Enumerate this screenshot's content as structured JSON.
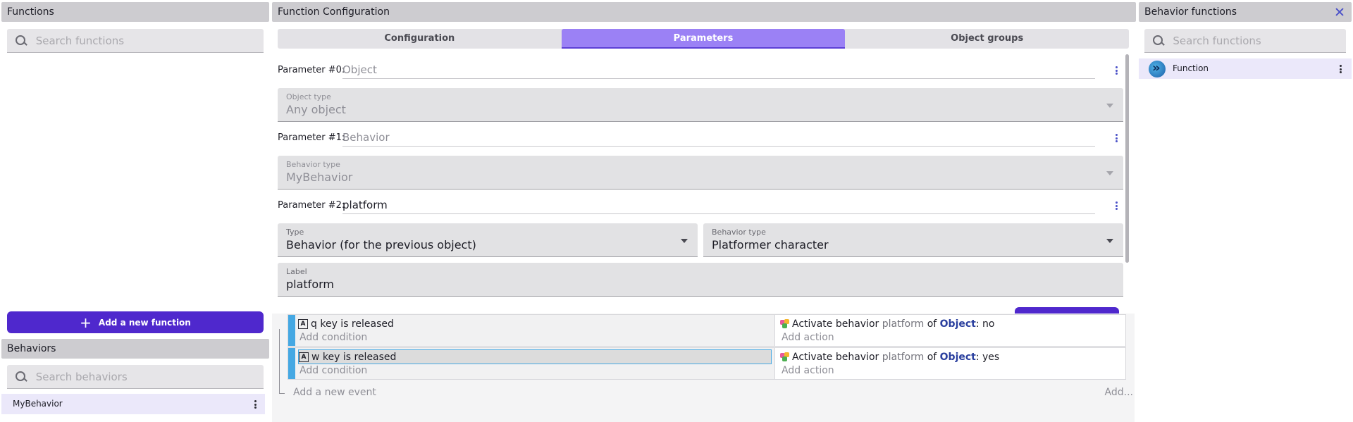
{
  "left": {
    "functions_title": "Functions",
    "functions_search_placeholder": "Search functions",
    "add_function_label": "Add a new function",
    "behaviors_title": "Behaviors",
    "behaviors_search_placeholder": "Search behaviors",
    "behavior_items": [
      "MyBehavior"
    ]
  },
  "center": {
    "title": "Function Configuration",
    "tabs": [
      "Configuration",
      "Parameters",
      "Object groups"
    ],
    "active_tab": "Parameters",
    "params": [
      {
        "label": "Parameter #0:",
        "value": "Object",
        "is_placeholder": true
      },
      {
        "label": "Parameter #1:",
        "value": "Behavior",
        "is_placeholder": true
      },
      {
        "label": "Parameter #2:",
        "value": "platform",
        "is_placeholder": false
      }
    ],
    "object_type": {
      "label": "Object type",
      "value": "Any object"
    },
    "behavior_type_disabled": {
      "label": "Behavior type",
      "value": "MyBehavior"
    },
    "type_field": {
      "label": "Type",
      "value": "Behavior (for the previous object)"
    },
    "behavior_type_field": {
      "label": "Behavior type",
      "value": "Platformer character"
    },
    "label_field": {
      "label": "Label",
      "value": "platform"
    }
  },
  "events": [
    {
      "key_letter": "A",
      "condition_key": "q",
      "condition_text": "key is released",
      "action_verb": "Activate behavior",
      "action_param": "platform",
      "action_of": "of",
      "action_object": "Object",
      "action_value": ": no",
      "selected": false
    },
    {
      "key_letter": "A",
      "condition_key": "w",
      "condition_text": "key is released",
      "action_verb": "Activate behavior",
      "action_param": "platform",
      "action_of": "of",
      "action_object": "Object",
      "action_value": ": yes",
      "selected": true
    }
  ],
  "event_links": {
    "add_condition": "Add condition",
    "add_action": "Add action",
    "add_new_event": "Add a new event",
    "add_more": "Add..."
  },
  "right": {
    "title": "Behavior functions",
    "search_placeholder": "Search functions",
    "items": [
      "Function"
    ]
  },
  "colors": {
    "accent": "#4f28cd",
    "active_tab": "#9b81f5",
    "selected_item": "#ebe8fa",
    "event_bar": "#45a8e3",
    "object_name": "#2a3f9e"
  },
  "icons": [
    "search-icon",
    "plus-icon",
    "kebab-icon",
    "close-icon",
    "chevron-down-icon",
    "keyboard-icon",
    "behavior-icon",
    "function-icon"
  ]
}
